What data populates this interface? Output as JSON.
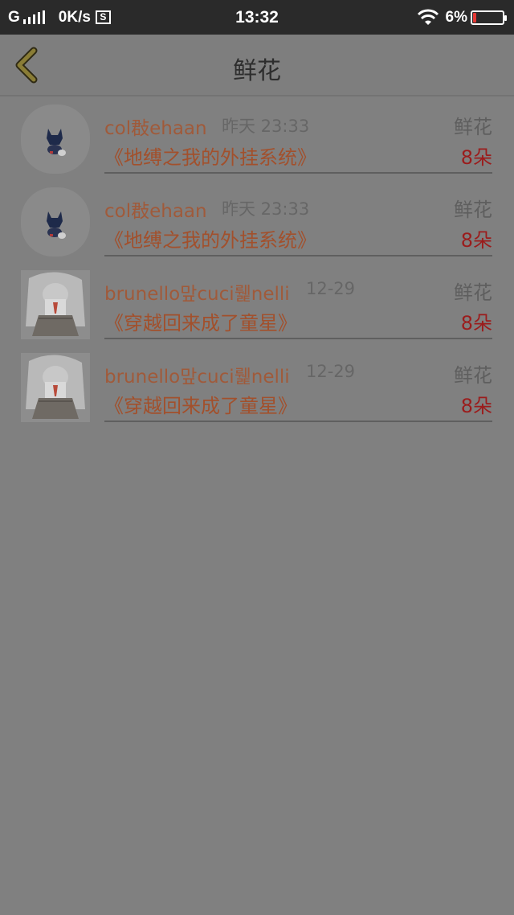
{
  "status_bar": {
    "network": "G",
    "speed": "0K/s",
    "s_label": "S",
    "time": "13:32",
    "battery": "6%"
  },
  "header": {
    "title": "鲜花",
    "back_icon": "chevron-left-icon"
  },
  "records": [
    {
      "user": "col㪊ehaan",
      "time": "昨天 23:33",
      "gift": "鲜花",
      "book": "《地缚之我的外挂系统》",
      "count": "8朵",
      "avatar": "dark-cat-avatar"
    },
    {
      "user": "col㪊ehaan",
      "time": "昨天 23:33",
      "gift": "鲜花",
      "book": "《地缚之我的外挂系统》",
      "count": "8朵",
      "avatar": "dark-cat-avatar"
    },
    {
      "user": "brunello맢cuci뤭nelli",
      "time": "12-29",
      "gift": "鲜花",
      "book": "《穿越回来成了童星》",
      "count": "8朵",
      "avatar": "anime-girl-avatar"
    },
    {
      "user": "brunello맢cuci뤭nelli",
      "time": "12-29",
      "gift": "鲜花",
      "book": "《穿越回来成了童星》",
      "count": "8朵",
      "avatar": "anime-girl-avatar"
    }
  ],
  "colors": {
    "overlay_bg": "#808080",
    "username": "#a05a3a",
    "book_title": "#a2502c",
    "count": "#9b1c1c",
    "battery_low": "#e53935"
  }
}
